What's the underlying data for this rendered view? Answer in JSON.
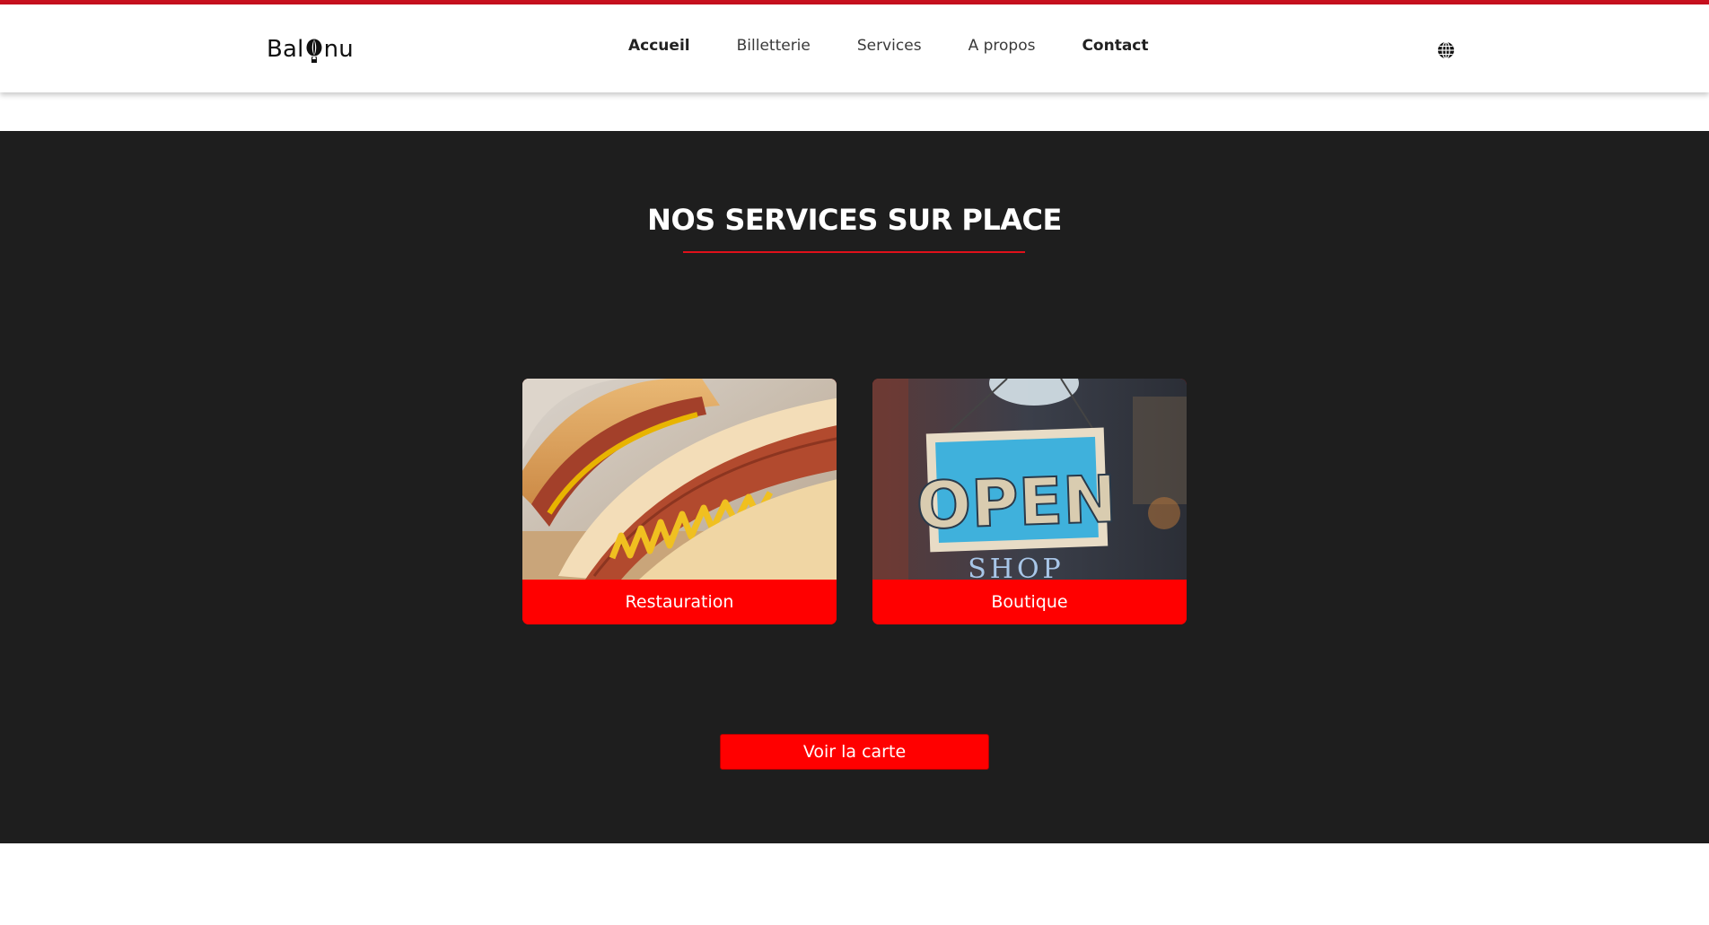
{
  "brand": {
    "logo_prefix": "Bal",
    "logo_suffix": "nu",
    "accent_color": "#c8101e",
    "button_color": "#ff0000",
    "section_bg": "#1e1e1e"
  },
  "nav": {
    "items": [
      {
        "label": "Accueil"
      },
      {
        "label": "Billetterie"
      },
      {
        "label": "Services"
      },
      {
        "label": "A propos"
      },
      {
        "label": "Contact"
      }
    ],
    "language_icon": "globe-icon"
  },
  "services": {
    "title": "NOS SERVICES SUR PLACE",
    "cards": [
      {
        "label": "Restauration",
        "image": "hot-dog-image"
      },
      {
        "label": "Boutique",
        "image": "open-sign-image",
        "image_text_main": "OPEN",
        "image_text_sub": "SHOP"
      }
    ],
    "cta_label": "Voir la carte"
  }
}
